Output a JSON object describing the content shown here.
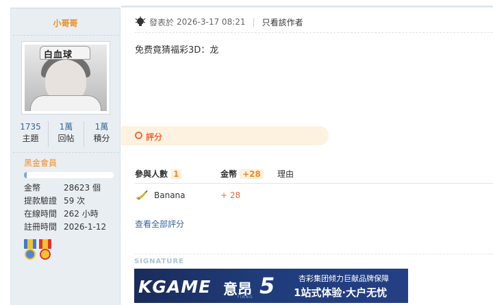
{
  "author": {
    "name": "小哥哥",
    "group": "黑金會員",
    "progress": 0.03,
    "stats": [
      {
        "value": "1735",
        "label": "主題"
      },
      {
        "value": "1萬",
        "label": "回帖"
      },
      {
        "value": "1萬",
        "label": "積分"
      }
    ],
    "info": [
      {
        "key": "金幣",
        "value": "28623 個"
      },
      {
        "key": "提款驗證",
        "value": "59 次"
      },
      {
        "key": "在線時間",
        "value": "262 小時"
      },
      {
        "key": "註冊時間",
        "value": "2026-1-12"
      }
    ],
    "avatar_text": "白血球",
    "medals": [
      "blue-medal-icon",
      "red-medal-icon"
    ]
  },
  "post": {
    "posted_prefix": "發表於",
    "posted_at": "2026-3-17 08:21",
    "only_author": "只看該作者",
    "content": "免费竟猜福彩3D：龙"
  },
  "rating": {
    "tab_label": "評分",
    "participants_label": "參與人數",
    "participants_count": "1",
    "coin_label": "金幣",
    "coin_total": "+28",
    "reason_label": "理由",
    "rows": [
      {
        "user": "Banana",
        "amount": "+ 28"
      }
    ],
    "view_all": "查看全部評分"
  },
  "signature": {
    "label": "SIGNATURE",
    "banner": {
      "brand": "KGAME",
      "name": "意昂",
      "name_sub": "YIANG",
      "number": "5",
      "line1": "杏彩集团倾力巨献品牌保障",
      "line2": "1站式体验·大户无忧"
    }
  },
  "colors": {
    "accent_orange": "#f08c1c",
    "link_blue": "#336699",
    "rate_red": "#ee6a3a",
    "sidebar_bg": "#e9eef3"
  }
}
